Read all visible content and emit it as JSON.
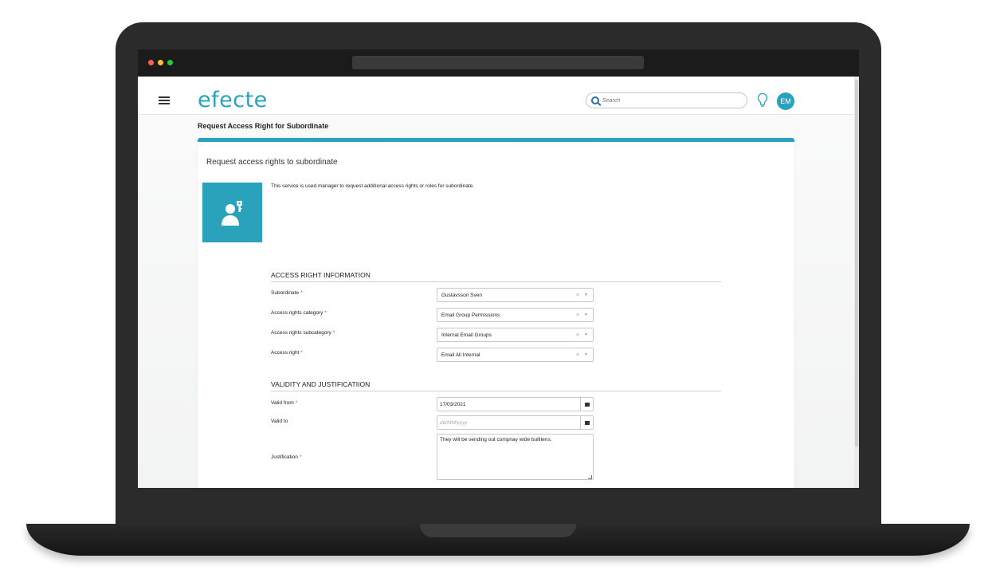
{
  "app": {
    "logo_text": "efecte",
    "search_placeholder": "Search",
    "avatar_initials": "EM",
    "accent_color": "#29a3bd"
  },
  "page": {
    "title": "Request Access Right for Subordinate"
  },
  "card": {
    "header": "Request access rights to subordinate",
    "description": "This service is used manager to request additional access rights or roles for subordinate.",
    "tile_icon": "user-key-icon"
  },
  "sections": {
    "access_info_title": "ACCESS RIGHT INFORMATION",
    "validity_title": "VALIDITY AND JUSTIFICATIION"
  },
  "fields": {
    "subordinate": {
      "label": "Subordinate",
      "value": "Gustavsson Sven"
    },
    "category": {
      "label": "Access rights category",
      "value": "Email Group Permissions"
    },
    "subcategory": {
      "label": "Access rights subcategory",
      "value": "Internal Email Groups"
    },
    "access_right": {
      "label": "Access right",
      "value": "Email All Internal"
    },
    "valid_from": {
      "label": "Valid from",
      "value": "17/03/2021"
    },
    "valid_to": {
      "label": "Valid to",
      "placeholder": "dd/MM/yyyy"
    },
    "justification": {
      "label": "Justification",
      "value": "They will be sending out compnay wide bullitens."
    }
  },
  "symbols": {
    "required": "*",
    "clear": "×",
    "caret": "▼"
  }
}
